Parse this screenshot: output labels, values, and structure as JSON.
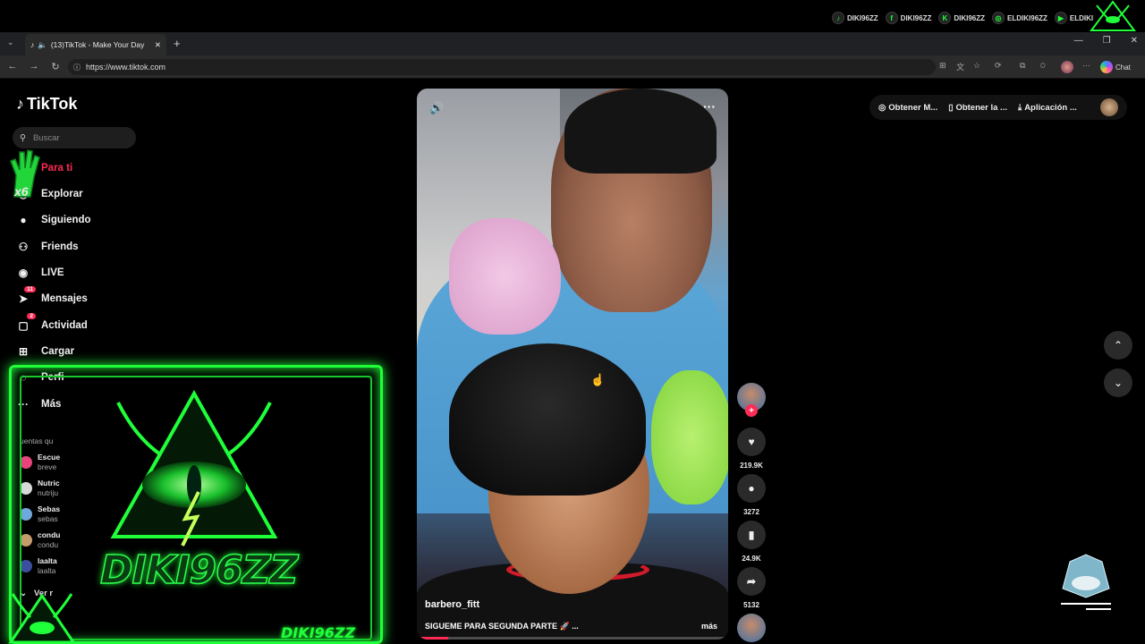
{
  "overlay": {
    "social": [
      {
        "icon": "tiktok-icon",
        "glyph": "♪",
        "handle": "DIKI96ZZ"
      },
      {
        "icon": "facebook-icon",
        "glyph": "f",
        "handle": "DIKI96ZZ"
      },
      {
        "icon": "kick-icon",
        "glyph": "K",
        "handle": "DIKI96ZZ"
      },
      {
        "icon": "instagram-icon",
        "glyph": "◎",
        "handle": "ELDIKI96ZZ"
      },
      {
        "icon": "youtube-icon",
        "glyph": "▶",
        "handle": "ELDIKI"
      }
    ],
    "brand": "DIKI96ZZ",
    "brand_corner": "DIKI96ZZ",
    "multiplier": "x6",
    "accent": "#1fff3a"
  },
  "browser": {
    "tab_title": "(13)TikTok - Make Your Day",
    "url": "https://www.tiktok.com",
    "chat_label": "Chat"
  },
  "tiktok": {
    "logo": "TikTok",
    "search_placeholder": "Buscar",
    "nav": [
      {
        "label": "Para ti",
        "icon": "home-icon",
        "glyph": "⌂",
        "badge": "",
        "active": true
      },
      {
        "label": "Explorar",
        "icon": "compass-icon",
        "glyph": "◎",
        "badge": "",
        "active": false
      },
      {
        "label": "Siguiendo",
        "icon": "following-avatar-icon",
        "glyph": "●",
        "badge": "",
        "active": false
      },
      {
        "label": "Friends",
        "icon": "friends-icon",
        "glyph": "⚇",
        "badge": "",
        "active": false
      },
      {
        "label": "LIVE",
        "icon": "live-icon",
        "glyph": "◉",
        "badge": "",
        "active": false
      },
      {
        "label": "Mensajes",
        "icon": "send-icon",
        "glyph": "➤",
        "badge": "11",
        "active": false
      },
      {
        "label": "Actividad",
        "icon": "activity-icon",
        "glyph": "▢",
        "badge": "2",
        "active": false
      },
      {
        "label": "Cargar",
        "icon": "upload-icon",
        "glyph": "⊞",
        "badge": "",
        "active": false
      },
      {
        "label": "Perfi",
        "icon": "profile-icon",
        "glyph": "◌",
        "badge": "",
        "active": false
      },
      {
        "label": "Más",
        "icon": "more-icon",
        "glyph": "···",
        "badge": "",
        "active": false
      }
    ],
    "following_heading": "uentas qu",
    "following": [
      {
        "name": "Escue",
        "sub": "breve",
        "color": "#e8437a"
      },
      {
        "name": "Nutric",
        "sub": "nutriju",
        "color": "#d9d9d9"
      },
      {
        "name": "Sebas",
        "sub": "sebas",
        "color": "#6fa8dc"
      },
      {
        "name": "condu",
        "sub": "condu",
        "color": "#c69c6d"
      },
      {
        "name": "laalta",
        "sub": "laalta",
        "color": "#3b4ea0"
      }
    ],
    "see_more": "Ver r",
    "active_color": "#fe2c55"
  },
  "video": {
    "author": "barbero_fitt",
    "caption": "SIGUEME PARA SEGUNDA PARTE 🚀 ...",
    "more": "más",
    "progress": 0.1,
    "likes": "219.9K",
    "comments": "3272",
    "saves": "24.9K",
    "shares": "5132"
  },
  "toolbar": {
    "items": [
      {
        "icon": "coin-icon",
        "glyph": "◎",
        "label": "Obtener M..."
      },
      {
        "icon": "phone-icon",
        "glyph": "▯",
        "label": "Obtener la ..."
      },
      {
        "icon": "download-icon",
        "glyph": "⤓",
        "label": "Aplicación ..."
      }
    ]
  }
}
